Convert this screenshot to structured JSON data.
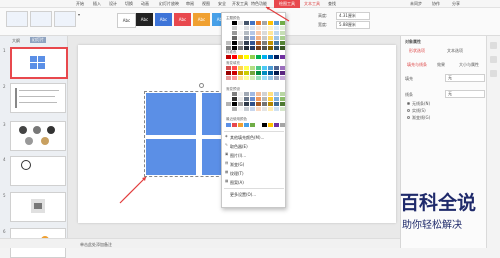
{
  "menu": {
    "items": [
      "开始",
      "插入",
      "设计",
      "切换",
      "动画",
      "幻灯片放映",
      "审阅",
      "视图",
      "安全",
      "开发工具",
      "特色功能",
      "绘图工具",
      "文本工具"
    ],
    "special_tab": "绘图工具",
    "search_label": "查找",
    "right_items": [
      "未同步",
      "协作",
      "分享"
    ]
  },
  "ribbon": {
    "style_labels": [
      "Abc",
      "Abc",
      "Abc",
      "Abc",
      "Abc",
      "Abc"
    ],
    "fill_label": "填充",
    "outline_label": "轮廓",
    "height_label": "高度:",
    "height_value": "4.31厘米",
    "width_label": "宽度:",
    "width_value": "5.88厘米"
  },
  "left_pane": {
    "tabs": [
      "大纲",
      "幻灯片"
    ],
    "slide_numbers": [
      "1",
      "2",
      "3",
      "4",
      "5",
      "6"
    ]
  },
  "dropdown": {
    "theme_colors_label": "主题颜色",
    "standard_colors_label": "标准色",
    "gradient_label": "渐变填充",
    "gradient2_label": "渐变预设",
    "recent_label": "最近使用颜色",
    "items": [
      "其他填充颜色(M)...",
      "取色器(E)",
      "图片(I)...",
      "渐变(G)",
      "纹理(T)",
      "图案(A)",
      "更多设置(O)..."
    ]
  },
  "right_panel": {
    "title": "对象属性",
    "tabs": [
      "形状选项",
      "文本选项"
    ],
    "subtabs": [
      "填充与线条",
      "效果",
      "大小与属性"
    ],
    "fill_label": "填充",
    "fill_value": "无",
    "line_label": "线条",
    "line_value": "无",
    "radio_options": [
      "无线条(N)",
      "实线(S)",
      "渐变线(G)"
    ]
  },
  "statusbar": {
    "notes_placeholder": "单击此处添加备注"
  },
  "watermark": {
    "title": "百科全说",
    "subtitle": "助你轻松解决"
  },
  "colors": {
    "accent": "#e8484d",
    "shape_blue": "#5b8fe6",
    "theme_row": [
      "#ffffff",
      "#000000",
      "#e7e6e6",
      "#44546a",
      "#4472c4",
      "#ed7d31",
      "#a5a5a5",
      "#ffc000",
      "#5b9bd5",
      "#70ad47"
    ],
    "standard_row": [
      "#c00000",
      "#ff0000",
      "#ffc000",
      "#ffff00",
      "#92d050",
      "#00b050",
      "#00b0f0",
      "#0070c0",
      "#002060",
      "#7030a0"
    ]
  }
}
